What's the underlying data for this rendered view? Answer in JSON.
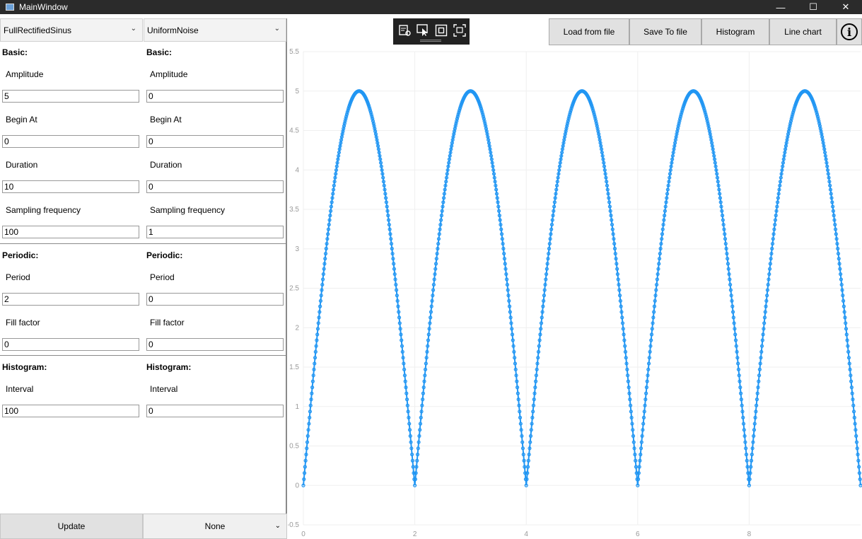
{
  "window": {
    "title": "MainWindow",
    "minimize": "—",
    "maximize": "☐",
    "close": "✕"
  },
  "left": {
    "signal1": {
      "type": "FullRectifiedSinus",
      "basic_title": "Basic:",
      "amplitude_label": "Amplitude",
      "amplitude": "5",
      "begin_label": "Begin At",
      "begin": "0",
      "duration_label": "Duration",
      "duration": "10",
      "sampling_label": "Sampling frequency",
      "sampling": "100",
      "periodic_title": "Periodic:",
      "period_label": "Period",
      "period": "2",
      "fill_label": "Fill factor",
      "fill": "0",
      "histogram_title": "Histogram:",
      "interval_label": "Interval",
      "interval": "100"
    },
    "signal2": {
      "type": "UniformNoise",
      "basic_title": "Basic:",
      "amplitude_label": "Amplitude",
      "amplitude": "0",
      "begin_label": "Begin At",
      "begin": "0",
      "duration_label": "Duration",
      "duration": "0",
      "sampling_label": "Sampling frequency",
      "sampling": "1",
      "periodic_title": "Periodic:",
      "period_label": "Period",
      "period": "0",
      "fill_label": "Fill factor",
      "fill": "0",
      "histogram_title": "Histogram:",
      "interval_label": "Interval",
      "interval": "0"
    },
    "update_label": "Update",
    "operation": "None"
  },
  "toolbar": {
    "icons": [
      "edit-chart-icon",
      "select-pointer-icon",
      "zoom-fit-icon",
      "screenshot-icon"
    ],
    "load_label": "Load from file",
    "save_label": "Save To file",
    "histogram_label": "Histogram",
    "linechart_label": "Line chart",
    "info_label": "i"
  },
  "chart_data": {
    "type": "line",
    "title": "",
    "xlabel": "",
    "ylabel": "",
    "xlim": [
      0,
      10
    ],
    "ylim": [
      -0.5,
      5.5
    ],
    "x_ticks": [
      0,
      2,
      4,
      6,
      8
    ],
    "y_ticks": [
      -0.5,
      0,
      0.5,
      1,
      1.5,
      2,
      2.5,
      3,
      3.5,
      4,
      4.5,
      5,
      5.5
    ],
    "series": [
      {
        "name": "",
        "color": "#2196f3",
        "function": "abs_sin",
        "amplitude": 5,
        "period": 2,
        "begin": 0,
        "duration": 10,
        "sampling_frequency": 100
      }
    ],
    "grid": true,
    "markers": true
  }
}
